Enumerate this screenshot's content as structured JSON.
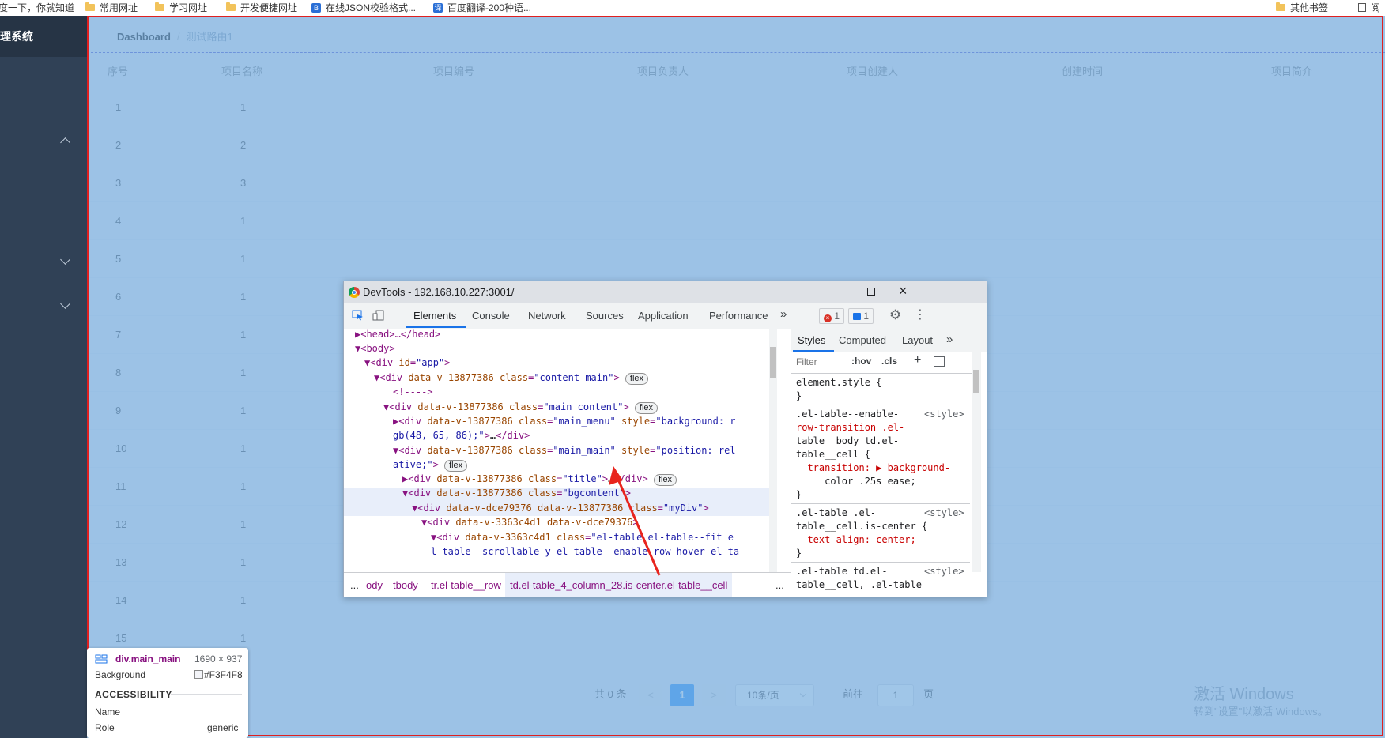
{
  "bookmarks": [
    {
      "label": "度一下，你就知道",
      "icon": "none"
    },
    {
      "label": "常用网址",
      "icon": "folder-icon"
    },
    {
      "label": "学习网址",
      "icon": "folder-icon"
    },
    {
      "label": "开发便捷网址",
      "icon": "folder-icon"
    },
    {
      "label": "在线JSON校验格式...",
      "icon": "json-icon"
    },
    {
      "label": "百度翻译-200种语...",
      "icon": "translate-icon"
    },
    {
      "label": "其他书签",
      "icon": "folder-icon"
    },
    {
      "label": "阅",
      "icon": "reading-list-icon"
    }
  ],
  "sidebar": {
    "brand": "管理系统"
  },
  "breadcrumb": {
    "home": "Dashboard",
    "sep": "/",
    "current": "测试路由1"
  },
  "table": {
    "headers": [
      "序号",
      "项目名称",
      "项目编号",
      "项目负责人",
      "项目创建人",
      "创建时间",
      "项目简介"
    ],
    "rows": [
      [
        "1",
        "1"
      ],
      [
        "2",
        "2"
      ],
      [
        "3",
        "3"
      ],
      [
        "4",
        "1"
      ],
      [
        "5",
        "1"
      ],
      [
        "6",
        "1"
      ],
      [
        "7",
        "1"
      ],
      [
        "8",
        "1"
      ],
      [
        "9",
        "1"
      ],
      [
        "10",
        "1"
      ],
      [
        "11",
        "1"
      ],
      [
        "12",
        "1"
      ],
      [
        "13",
        "1"
      ],
      [
        "14",
        "1"
      ],
      [
        "15",
        "1"
      ]
    ]
  },
  "pagination": {
    "total": "共 0 条",
    "prev": "<",
    "page": "1",
    "next": ">",
    "size": "10条/页",
    "goto": "前往",
    "goto_value": "1",
    "goto_suffix": "页"
  },
  "watermark": {
    "line1": "激活 Windows",
    "line2": "转到\"设置\"以激活 Windows。"
  },
  "tooltip": {
    "element": "div.main_main",
    "size": "1690 × 937",
    "background_label": "Background",
    "background_value": "#F3F4F8",
    "section": "ACCESSIBILITY",
    "name_label": "Name",
    "role_label": "Role",
    "role_value": "generic"
  },
  "devtools": {
    "title": "DevTools - 192.168.10.227:3001/",
    "tabs": [
      "Elements",
      "Console",
      "Network",
      "Sources",
      "Application",
      "Performance"
    ],
    "more": "»",
    "errors": "1",
    "messages": "1",
    "dom_lines": [
      "▶<head>…</head>",
      "▼<body>",
      "▼<div id=\"app\">",
      "▼<div data-v-13877386 class=\"content main\">",
      "<!---->",
      "▼<div data-v-13877386 class=\"main_content\">",
      "▶<div data-v-13877386 class=\"main_menu\" style=\"background: r",
      "gb(48, 65, 86);\">…</div>",
      "▼<div data-v-13877386 class=\"main_main\" style=\"position: rel",
      "ative;\">",
      "▶<div data-v-13877386 class=\"title\">…</div>",
      "▼<div data-v-13877386 class=\"bgcontent\">",
      "▼<div data-v-dce79376 data-v-13877386 class=\"myDiv\">",
      "▼<div data-v-3363c4d1 data-v-dce79376>",
      "▼<div data-v-3363c4d1 class=\"el-table el-table--fit e",
      "l-table--scrollable-y el-table--enable-row-hover el-ta"
    ],
    "flex_badge": "flex",
    "crumbs": [
      "...",
      "ody",
      "tbody",
      "tr.el-table__row",
      "td.el-table_4_column_28.is-center.el-table__cell",
      "..."
    ],
    "styles_tabs": [
      "Styles",
      "Computed",
      "Layout",
      "»"
    ],
    "filter_placeholder": "Filter",
    "hov": ":hov",
    "cls": ".cls",
    "plus": "+",
    "style_lines": [
      {
        "t": "element.style {",
        "src": ""
      },
      {
        "t": "}",
        "src": ""
      },
      {
        "t": ".el-table--enable-",
        "src": "<style>"
      },
      {
        "t": "row-transition .el-",
        "src": ""
      },
      {
        "t": "table__body td.el-",
        "src": ""
      },
      {
        "t": "table__cell {",
        "src": ""
      },
      {
        "t": "  transition: ▶ background-",
        "src": ""
      },
      {
        "t": "     color .25s ease;",
        "src": ""
      },
      {
        "t": "}",
        "src": ""
      },
      {
        "t": ".el-table .el-",
        "src": "<style>"
      },
      {
        "t": "table__cell.is-center {",
        "src": ""
      },
      {
        "t": "  text-align: center;",
        "src": ""
      },
      {
        "t": "}",
        "src": ""
      },
      {
        "t": ".el-table td.el-",
        "src": "<style>"
      },
      {
        "t": "table__cell, .el-table",
        "src": ""
      }
    ]
  },
  "colors": {
    "sidebar": "#304156",
    "accent": "#409eff",
    "overlay": "#6fa8dc",
    "outline": "#e02020"
  }
}
